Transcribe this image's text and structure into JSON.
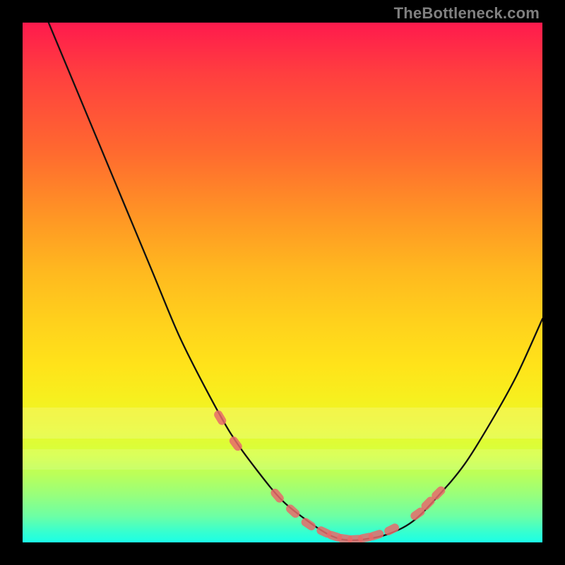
{
  "watermark": "TheBottleneck.com",
  "colors": {
    "background": "#000000",
    "curve": "#111111",
    "marker": "#e86a6a",
    "gradient_top": "#ff1a4d",
    "gradient_bottom": "#1bffe6"
  },
  "chart_data": {
    "type": "line",
    "title": "",
    "xlabel": "",
    "ylabel": "",
    "xlim": [
      0,
      100
    ],
    "ylim": [
      0,
      100
    ],
    "axes_visible": false,
    "grid": false,
    "legend": false,
    "series": [
      {
        "name": "bottleneck-curve",
        "x": [
          5,
          10,
          15,
          20,
          25,
          30,
          35,
          40,
          45,
          50,
          55,
          58,
          60,
          62,
          65,
          70,
          75,
          80,
          85,
          90,
          95,
          100
        ],
        "y": [
          100,
          88,
          76,
          64,
          52,
          40,
          30,
          21,
          14,
          8,
          4,
          2,
          1,
          0.5,
          0.5,
          1.5,
          4,
          9,
          15,
          23,
          32,
          43
        ]
      }
    ],
    "markers": [
      {
        "name": "highlighted-points",
        "style": "rounded-segment",
        "points": [
          {
            "x": 38,
            "y": 24
          },
          {
            "x": 41,
            "y": 19
          },
          {
            "x": 49,
            "y": 9
          },
          {
            "x": 52,
            "y": 6
          },
          {
            "x": 55,
            "y": 3.5
          },
          {
            "x": 58,
            "y": 2
          },
          {
            "x": 60,
            "y": 1.2
          },
          {
            "x": 62,
            "y": 0.7
          },
          {
            "x": 64,
            "y": 0.6
          },
          {
            "x": 66,
            "y": 0.9
          },
          {
            "x": 68,
            "y": 1.4
          },
          {
            "x": 71,
            "y": 2.5
          },
          {
            "x": 76,
            "y": 5.5
          },
          {
            "x": 78,
            "y": 7.5
          },
          {
            "x": 80,
            "y": 9.5
          }
        ]
      }
    ],
    "haze_bands": [
      {
        "y_from": 74,
        "y_to": 80,
        "opacity": 0.18
      },
      {
        "y_from": 82,
        "y_to": 86,
        "opacity": 0.14
      }
    ]
  }
}
